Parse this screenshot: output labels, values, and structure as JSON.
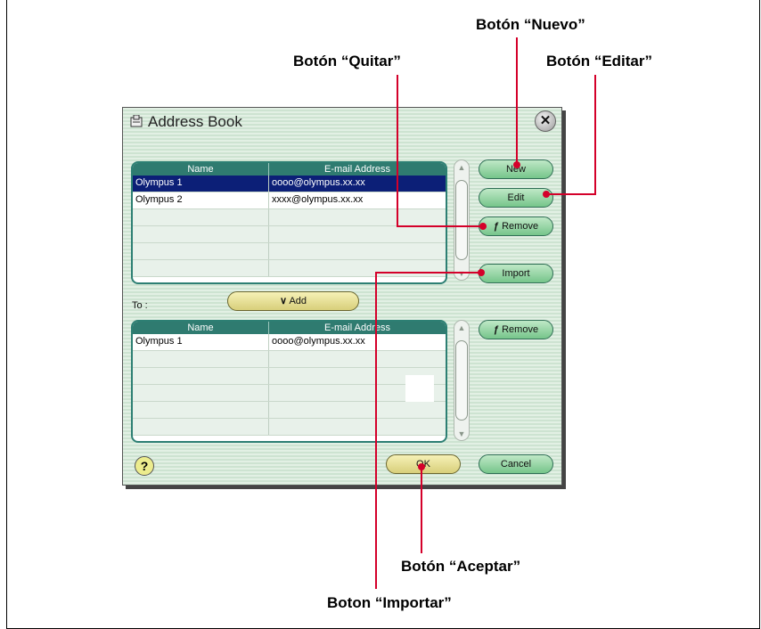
{
  "annotations": {
    "nuevo": "Botón “Nuevo”",
    "quitar": "Botón “Quitar”",
    "editar": "Botón “Editar”",
    "aceptar": "Botón “Aceptar”",
    "importar": "Boton “Importar”"
  },
  "dialog": {
    "title": "Address Book",
    "close_icon": "close-icon",
    "top_list": {
      "columns": [
        "Name",
        "E-mail Address"
      ],
      "rows": [
        {
          "name": "Olympus 1",
          "email": "oooo@olympus.xx.xx",
          "selected": true
        },
        {
          "name": "Olympus 2",
          "email": "xxxx@olympus.xx.xx",
          "selected": false
        }
      ]
    },
    "buttons": {
      "new": "New",
      "edit": "Edit",
      "remove": "Remove",
      "import": "Import",
      "add": "Add",
      "remove2": "Remove",
      "ok": "OK",
      "cancel": "Cancel",
      "help": "?"
    },
    "to_label": "To :",
    "bottom_list": {
      "columns": [
        "Name",
        "E-mail Address"
      ],
      "rows": [
        {
          "name": "Olympus 1",
          "email": "oooo@olympus.xx.xx"
        }
      ]
    }
  },
  "colors": {
    "leader": "#d4002a",
    "header": "#2f7b70",
    "selection": "#0c1f77"
  }
}
